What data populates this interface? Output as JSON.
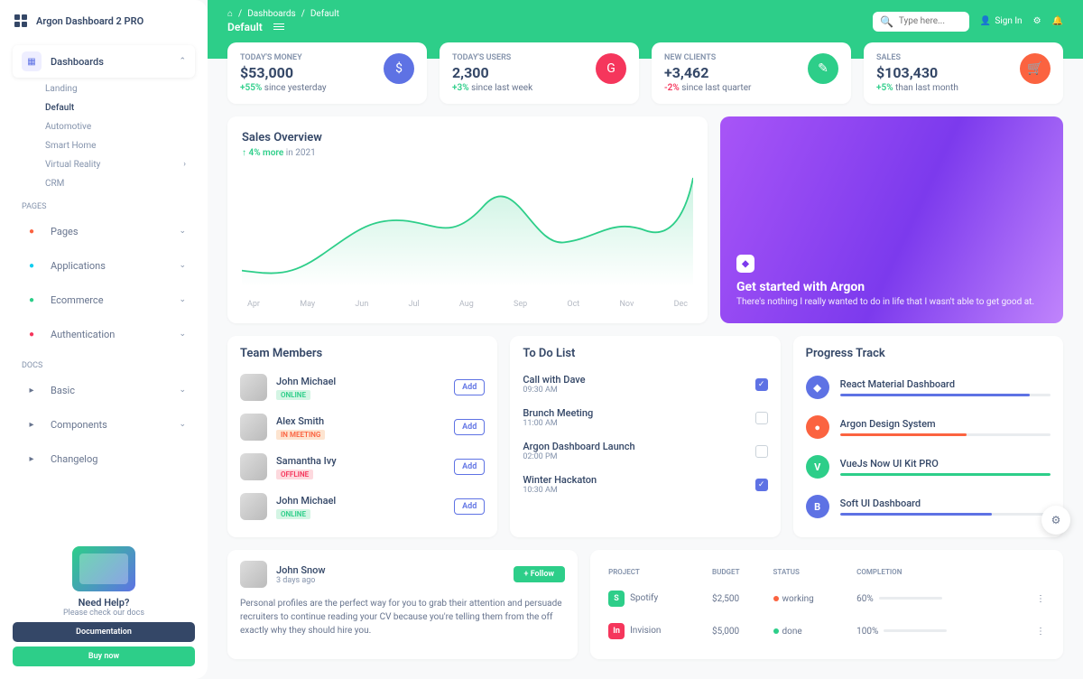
{
  "brand": "Argon Dashboard 2 PRO",
  "sidebar": {
    "dashboards_label": "Dashboards",
    "subs": [
      "Landing",
      "Default",
      "Automotive",
      "Smart Home",
      "Virtual Reality",
      "CRM"
    ],
    "pages_header": "PAGES",
    "items": [
      {
        "label": "Pages",
        "color": "#fb6340"
      },
      {
        "label": "Applications",
        "color": "#11cdef"
      },
      {
        "label": "Ecommerce",
        "color": "#2dce89"
      },
      {
        "label": "Authentication",
        "color": "#f5365c"
      }
    ],
    "docs_header": "DOCS",
    "docs": [
      {
        "label": "Basic"
      },
      {
        "label": "Components"
      },
      {
        "label": "Changelog"
      }
    ],
    "help_title": "Need Help?",
    "help_sub": "Please check our docs",
    "doc_btn": "Documentation",
    "buy_btn": "Buy now"
  },
  "breadcrumb": {
    "a": "Dashboards",
    "b": "Default",
    "page": "Default"
  },
  "search_placeholder": "Type here...",
  "signin": "Sign In",
  "stats": [
    {
      "label": "TODAY'S MONEY",
      "value": "$53,000",
      "pct": "+55%",
      "dir": "up",
      "suffix": " since yesterday",
      "icon": "$",
      "bg": "#5e72e4"
    },
    {
      "label": "TODAY'S USERS",
      "value": "2,300",
      "pct": "+3%",
      "dir": "up",
      "suffix": " since last week",
      "icon": "G",
      "bg": "#f5365c"
    },
    {
      "label": "NEW CLIENTS",
      "value": "+3,462",
      "pct": "-2%",
      "dir": "down",
      "suffix": " since last quarter",
      "icon": "✎",
      "bg": "#2dce89"
    },
    {
      "label": "SALES",
      "value": "$103,430",
      "pct": "+5%",
      "dir": "up",
      "suffix": " than last month",
      "icon": "🛒",
      "bg": "#fb6340"
    }
  ],
  "chart": {
    "title": "Sales Overview",
    "sub_icon": "↑",
    "sub_pct": "4% more",
    "sub_suffix": " in 2021",
    "months": [
      "Apr",
      "May",
      "Jun",
      "Jul",
      "Aug",
      "Sep",
      "Oct",
      "Nov",
      "Dec"
    ]
  },
  "chart_data": {
    "type": "line",
    "title": "Sales Overview",
    "categories": [
      "Apr",
      "May",
      "Jun",
      "Jul",
      "Aug",
      "Sep",
      "Oct",
      "Nov",
      "Dec"
    ],
    "values": [
      50,
      38,
      300,
      220,
      500,
      250,
      400,
      230,
      500
    ],
    "ylim": [
      0,
      600
    ]
  },
  "promo": {
    "title": "Get started with Argon",
    "text": "There's nothing I really wanted to do in life that I wasn't able to get good at."
  },
  "team": {
    "title": "Team Members",
    "add": "Add",
    "members": [
      {
        "name": "John Michael",
        "status": "ONLINE",
        "cls": "online"
      },
      {
        "name": "Alex Smith",
        "status": "IN MEETING",
        "cls": "meeting"
      },
      {
        "name": "Samantha Ivy",
        "status": "OFFLINE",
        "cls": "offline"
      },
      {
        "name": "John Michael",
        "status": "ONLINE",
        "cls": "online"
      }
    ]
  },
  "todo": {
    "title": "To Do List",
    "items": [
      {
        "t": "Call with Dave",
        "tm": "09:30 AM",
        "done": true
      },
      {
        "t": "Brunch Meeting",
        "tm": "11:00 AM",
        "done": false
      },
      {
        "t": "Argon Dashboard Launch",
        "tm": "02:00 PM",
        "done": false
      },
      {
        "t": "Winter Hackaton",
        "tm": "10:30 AM",
        "done": true
      }
    ]
  },
  "progress": {
    "title": "Progress Track",
    "items": [
      {
        "name": "React Material Dashboard",
        "pct": 90,
        "color": "#5e72e4",
        "icon": "◆"
      },
      {
        "name": "Argon Design System",
        "pct": 60,
        "color": "#fb6340",
        "icon": "●"
      },
      {
        "name": "VueJs Now UI Kit PRO",
        "pct": 100,
        "color": "#2dce89",
        "icon": "V"
      },
      {
        "name": "Soft UI Dashboard",
        "pct": 72,
        "color": "#5e72e4",
        "icon": "B"
      }
    ]
  },
  "profile": {
    "name": "John Snow",
    "time": "3 days ago",
    "follow": "+ Follow",
    "desc": "Personal profiles are the perfect way for you to grab their attention and persuade recruiters to continue reading your CV because you're telling them from the off exactly why they should hire you."
  },
  "projects": {
    "headers": [
      "PROJECT",
      "BUDGET",
      "STATUS",
      "COMPLETION",
      ""
    ],
    "rows": [
      {
        "name": "Spotify",
        "budget": "$2,500",
        "status": "working",
        "scolor": "#fb6340",
        "pct": 60,
        "icon": "S",
        "ibg": "#2dce89"
      },
      {
        "name": "Invision",
        "budget": "$5,000",
        "status": "done",
        "scolor": "#2dce89",
        "pct": 100,
        "icon": "In",
        "ibg": "#f5365c"
      }
    ]
  }
}
